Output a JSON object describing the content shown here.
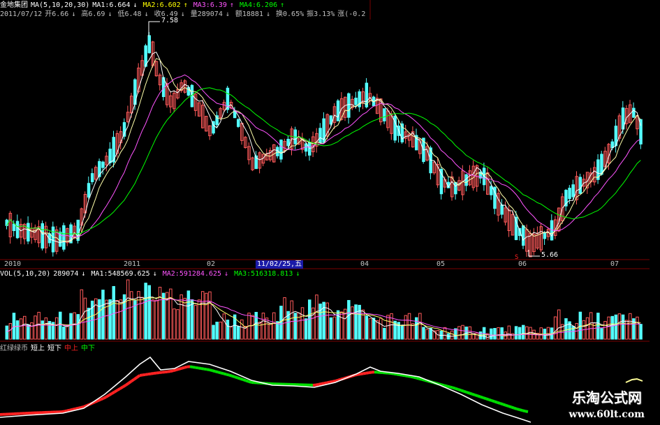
{
  "header": {
    "stock_name": "金地集团",
    "ma_label": "MA(5,10,20,30)",
    "ma1": "MA1:6.664",
    "ma1_arrow": "↓",
    "ma2": "MA2:6.602",
    "ma2_arrow": "↑",
    "ma3": "MA3:6.39",
    "ma3_arrow": "↑",
    "ma4": "MA4:6.206",
    "ma4_arrow": "↑"
  },
  "quote": {
    "date": "2011/07/12",
    "open": "开6.66",
    "high": "高6.69",
    "low": "低6.48",
    "close": "收6.49",
    "volume": "量289074",
    "amount": "额18881",
    "turnover": "换0.65%",
    "amplitude": "振3.13%",
    "change": "涨(-0.2",
    "arrow_down": "↓"
  },
  "price_marks": {
    "high": "7.58",
    "low": "5.66"
  },
  "date_axis": [
    {
      "label": "2010",
      "pos": 0.006
    },
    {
      "label": "2011",
      "pos": 0.19
    },
    {
      "label": "02",
      "pos": 0.318
    },
    {
      "label": "11/02/25,五",
      "pos": 0.394,
      "highlight": true
    },
    {
      "label": "04",
      "pos": 0.555
    },
    {
      "label": "05",
      "pos": 0.672
    },
    {
      "label": "06",
      "pos": 0.798
    },
    {
      "label": "07",
      "pos": 0.94
    }
  ],
  "volume_header": {
    "label": "VOL(5,10,20)",
    "value": "289074",
    "ma1": "MA1:548569.625",
    "ma2": "MA2:591284.625",
    "ma3": "MA3:516318.813",
    "arrow": "↓"
  },
  "indicator_header": {
    "name": "红绿绿币",
    "short_up": "短上",
    "short_down": "短下",
    "mid_up": "中上",
    "mid_down": "中下"
  },
  "watermark": {
    "cn": "乐淘公式网",
    "url": "www.60lt.com"
  },
  "colors": {
    "background": "#000000",
    "up_candle": "#ff5a5a",
    "down_candle": "#54ffff",
    "ma1": "#ffffff",
    "ma2": "#ffff00",
    "ma3": "#ff55ff",
    "ma4": "#00ff00",
    "separator": "#7a0000"
  }
}
